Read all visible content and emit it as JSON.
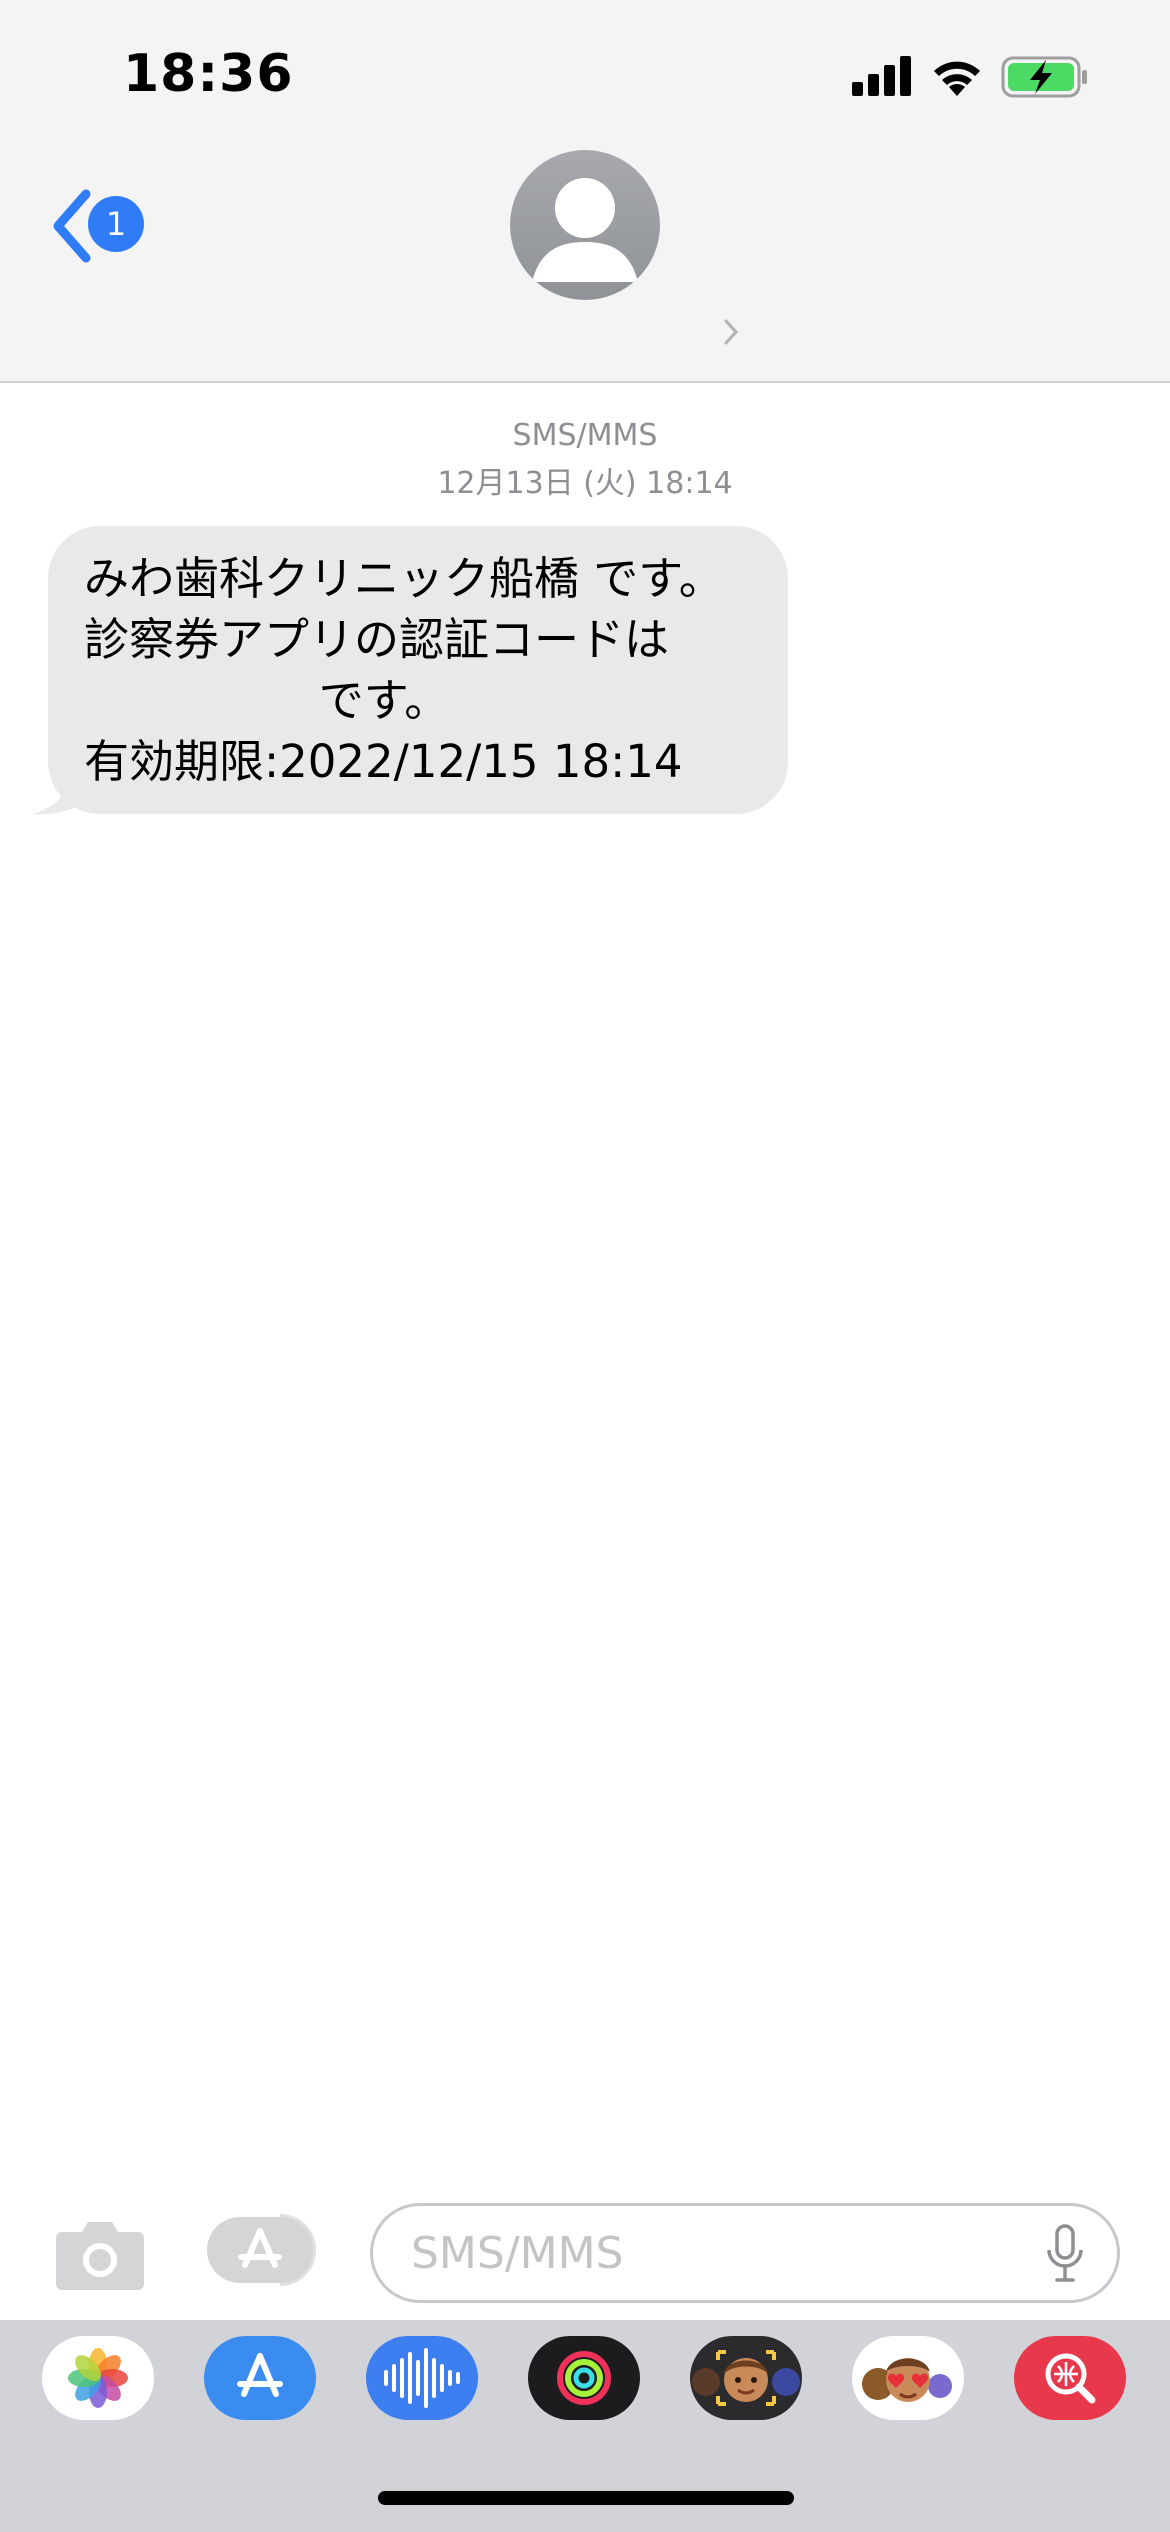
{
  "status_bar": {
    "time": "18:36"
  },
  "nav": {
    "back_badge": "1"
  },
  "conversation": {
    "service": "SMS/MMS",
    "timestamp": "12月13日 (火) 18:14"
  },
  "message": {
    "lines": [
      "みわ歯科クリニック船橋 です。",
      "診察券アプリの認証コードは",
      "です。",
      "有効期限:2022/12/15 18:14"
    ]
  },
  "composer": {
    "placeholder": "SMS/MMS"
  },
  "app_tray": {
    "apps": [
      "photos-icon",
      "app-store-icon",
      "audio-messages-icon",
      "activity-icon",
      "memoji-icon",
      "memoji-stickers-icon",
      "search-images-icon"
    ]
  },
  "colors": {
    "accent": "#2f7cf6",
    "bubble": "#e9e9eb",
    "header_bg": "#f4f4f4",
    "tray_bg": "#d1d3d8"
  }
}
